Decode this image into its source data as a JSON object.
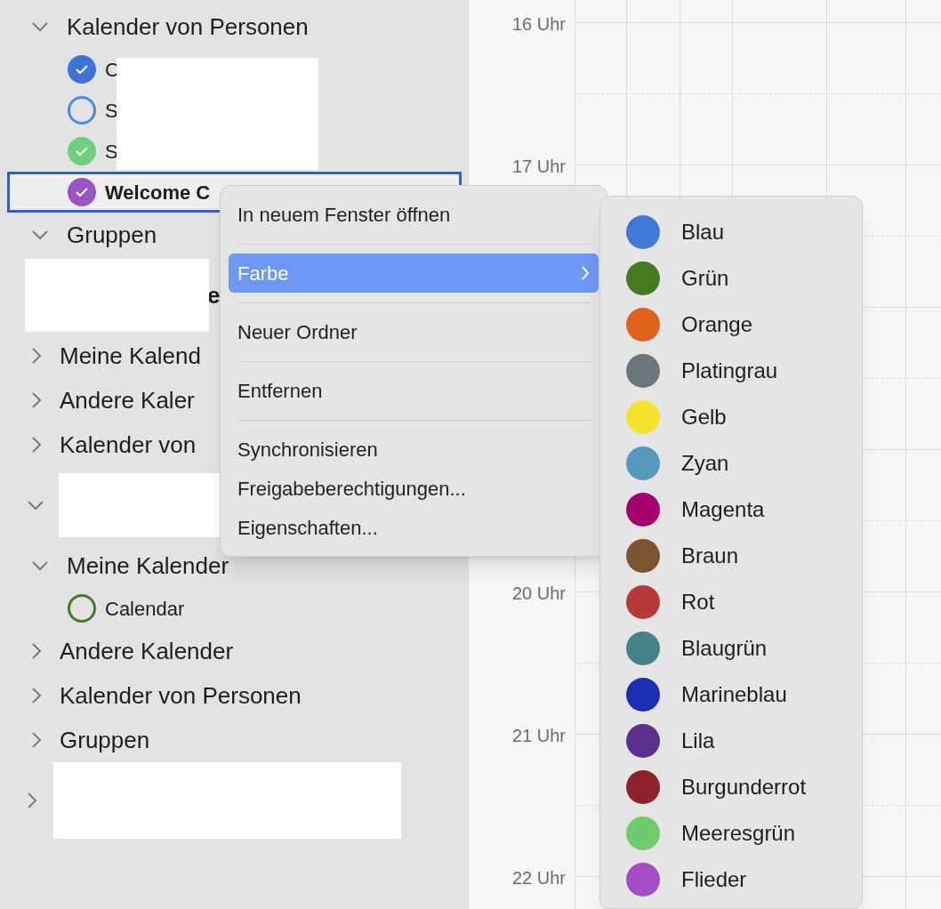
{
  "sidebar": {
    "rows": [
      {
        "kind": "group",
        "label": "Kalender von Personen",
        "expanded": true
      },
      {
        "kind": "calendar",
        "label": "C",
        "checked": true,
        "color": "#3b73d6",
        "selected": false
      },
      {
        "kind": "calendar",
        "label": "S",
        "checked": false,
        "color": "#4a8ae0",
        "selected": false
      },
      {
        "kind": "calendar",
        "label": "S",
        "checked": true,
        "color": "#6fcf7f",
        "selected": false
      },
      {
        "kind": "calendar",
        "label": "Welcome C",
        "checked": true,
        "color": "#9a55c4",
        "selected": true
      },
      {
        "kind": "group",
        "label": "Gruppen",
        "expanded": true
      },
      {
        "kind": "account",
        "label": "e"
      },
      {
        "kind": "group",
        "label": "Meine Kalend",
        "expanded": false
      },
      {
        "kind": "group",
        "label": "Andere Kaler",
        "expanded": false
      },
      {
        "kind": "group",
        "label": "Kalender von",
        "expanded": false
      },
      {
        "kind": "account",
        "expanded": true
      },
      {
        "kind": "group",
        "label": "Meine Kalender",
        "expanded": true
      },
      {
        "kind": "calendar",
        "label": "Calendar",
        "checked": false,
        "color": "#467a26",
        "selected": false
      },
      {
        "kind": "group",
        "label": "Andere Kalender",
        "expanded": false
      },
      {
        "kind": "group",
        "label": "Kalender von Personen",
        "expanded": false
      },
      {
        "kind": "group",
        "label": "Gruppen",
        "expanded": false
      },
      {
        "kind": "account",
        "expanded": false
      }
    ]
  },
  "calendar": {
    "hour_rows": [
      {
        "label": "16 Uhr"
      },
      {
        "label": "17 Uhr"
      },
      {},
      {},
      {
        "label": "20 Uhr"
      },
      {
        "label": "21 Uhr"
      },
      {
        "label": "22 Uhr"
      }
    ]
  },
  "context_menu": {
    "items": [
      {
        "kind": "item",
        "label": "In neuem Fenster öffnen",
        "selected": false,
        "submenu": false
      },
      {
        "kind": "separator"
      },
      {
        "kind": "item",
        "label": "Farbe",
        "selected": true,
        "submenu": true
      },
      {
        "kind": "separator"
      },
      {
        "kind": "item",
        "label": "Neuer Ordner",
        "selected": false,
        "submenu": false
      },
      {
        "kind": "separator"
      },
      {
        "kind": "item",
        "label": "Entfernen",
        "selected": false,
        "submenu": false
      },
      {
        "kind": "separator"
      },
      {
        "kind": "item",
        "label": "Synchronisieren",
        "selected": false,
        "submenu": false
      },
      {
        "kind": "item",
        "label": "Freigabeberechtigungen...",
        "selected": false,
        "submenu": false
      },
      {
        "kind": "item",
        "label": "Eigenschaften...",
        "selected": false,
        "submenu": false
      }
    ]
  },
  "color_submenu": {
    "items": [
      {
        "label": "Blau",
        "color": "#4279d6"
      },
      {
        "label": "Grün",
        "color": "#447a22"
      },
      {
        "label": "Orange",
        "color": "#e0621c"
      },
      {
        "label": "Platingrau",
        "color": "#6c757a"
      },
      {
        "label": "Gelb",
        "color": "#f4e231"
      },
      {
        "label": "Zyan",
        "color": "#5599bc"
      },
      {
        "label": "Magenta",
        "color": "#a3006e"
      },
      {
        "label": "Braun",
        "color": "#7d5432"
      },
      {
        "label": "Rot",
        "color": "#b9393a"
      },
      {
        "label": "Blaugrün",
        "color": "#468386"
      },
      {
        "label": "Marineblau",
        "color": "#1a2fb3"
      },
      {
        "label": "Lila",
        "color": "#5a2f8e"
      },
      {
        "label": "Burgunderrot",
        "color": "#8b2328"
      },
      {
        "label": "Meeresgrün",
        "color": "#6fcb70"
      },
      {
        "label": "Flieder",
        "color": "#a44bc6"
      }
    ]
  }
}
